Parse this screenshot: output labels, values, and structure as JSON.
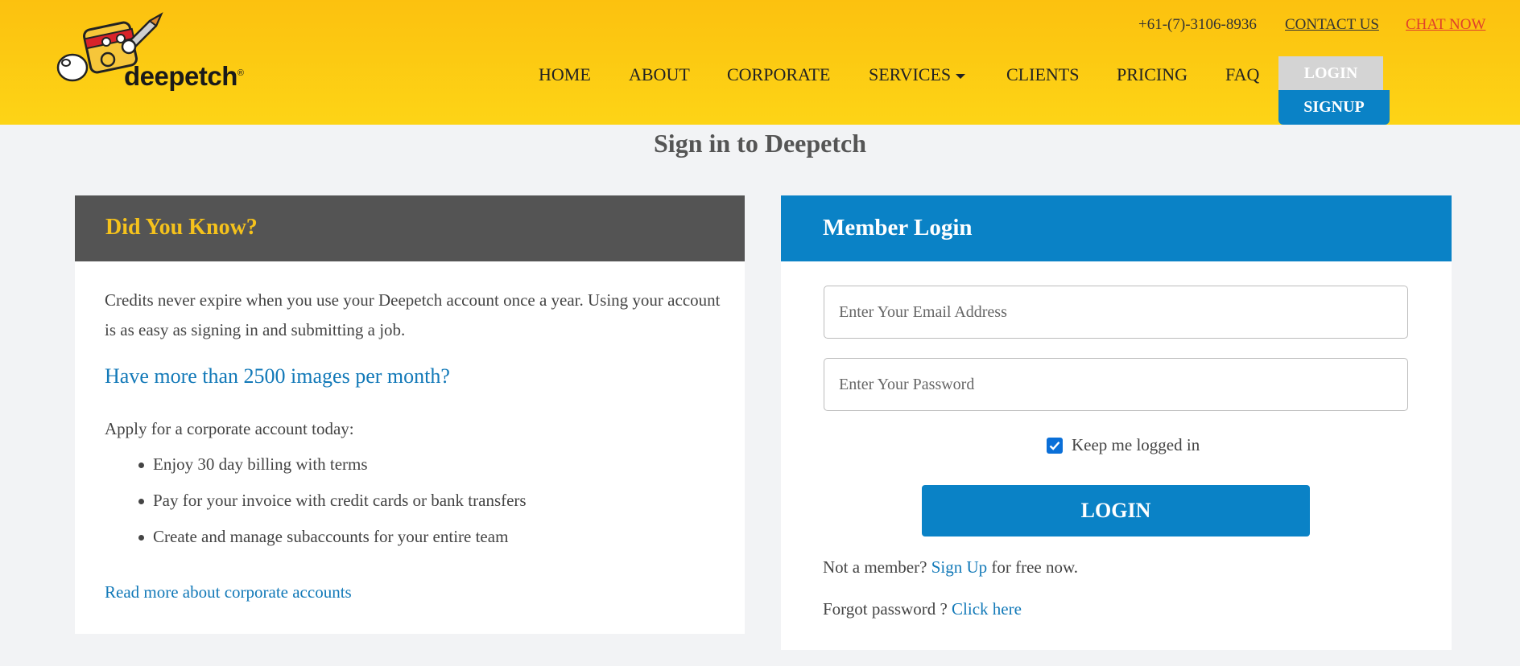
{
  "header": {
    "logo_text": "deepetch",
    "logo_mark": "®",
    "phone": "+61-(7)-3106-8936",
    "contact_label": "CONTACT US",
    "chat_label": "CHAT NOW",
    "nav": [
      "HOME",
      "ABOUT",
      "CORPORATE",
      "SERVICES",
      "CLIENTS",
      "PRICING",
      "FAQ"
    ],
    "login_label": "LOGIN",
    "signup_label": "SIGNUP",
    "colors": {
      "header_bg": "#fcc10f",
      "login_bg": "#d4d4d4",
      "signup_bg": "#0a82c6",
      "chat": "#e0402a"
    }
  },
  "page_title": "Sign in to Deepetch",
  "did_you_know": {
    "title": "Did You Know?",
    "paragraph": "Credits never expire when you use your Deepetch account once a year. Using your account is as easy as signing in and submitting a job.",
    "question": "Have more than 2500 images per month?",
    "apply_text": "Apply for a corporate account today:",
    "bullets": [
      "Enjoy 30 day billing with terms",
      "Pay for your invoice with credit cards or bank transfers",
      "Create and manage subaccounts for your entire team"
    ],
    "read_more": "Read more about corporate accounts"
  },
  "member_login": {
    "title": "Member Login",
    "email_placeholder": "Enter Your Email Address",
    "password_placeholder": "Enter Your Password",
    "keep_label": "Keep me logged in",
    "keep_checked": true,
    "login_button": "LOGIN",
    "not_member_prefix": "Not a member?",
    "signup_link": "Sign Up",
    "not_member_suffix": "for free now.",
    "forgot_prefix": "Forgot password ?",
    "forgot_link": "Click here",
    "colors": {
      "header_bg": "#0a82c6",
      "button_bg": "#0a82c6",
      "link": "#1279b8"
    }
  }
}
